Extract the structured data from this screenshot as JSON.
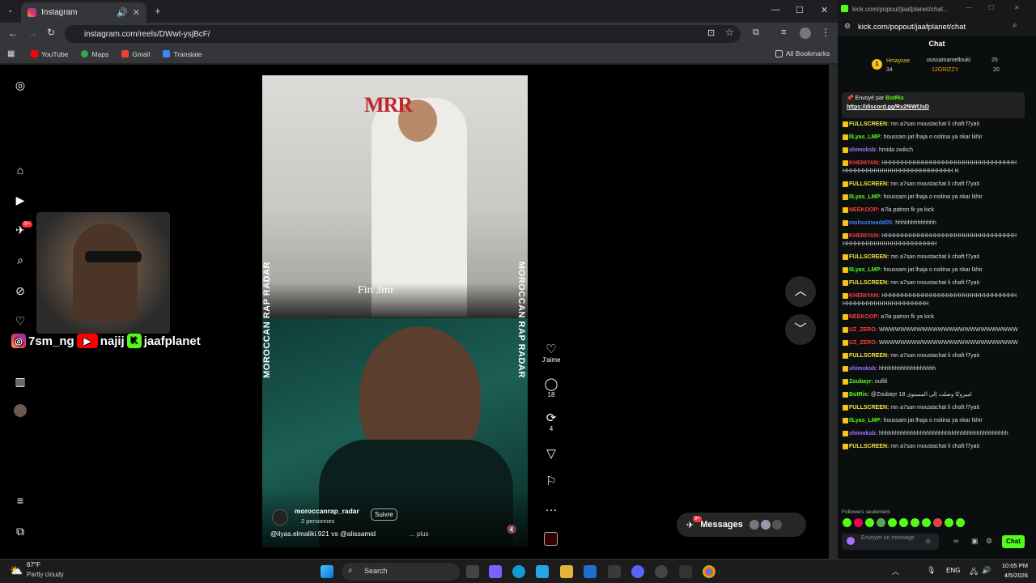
{
  "browser": {
    "tab_title": "Instagram",
    "url": "instagram.com/reels/DWwt-ysjBcF/",
    "bookmarks": [
      "YouTube",
      "Maps",
      "Gmail",
      "Translate"
    ],
    "all_bookmarks": "All Bookmarks"
  },
  "reel": {
    "top_caption": "Fin 3mr",
    "logo": "MRR",
    "side_text": "MOROCCAN RAP RADAR",
    "account": "moroccanrap_radar",
    "follow": "Suivre",
    "people": "2 personnes",
    "caption": "@ilyas.elmaliki.921 vs @alissamid",
    "more": "... plus",
    "likes_label": "J'aime",
    "comments": "18",
    "reposts": "4"
  },
  "messages": {
    "label": "Messages",
    "badge": "9+"
  },
  "notif_badge": "9+",
  "overlay": {
    "insta": "7sm_ng",
    "yt": "najij",
    "kick": "jaafplanet"
  },
  "chat_window": {
    "title": "kick.com/popout/jaafplanet/chat...",
    "url": "kick.com/popout/jaafplanet/chat",
    "heading": "Chat",
    "top1_name": "Hmaysse",
    "top1_val": "34",
    "top2_name": "oussamamellouki",
    "top2_val": "25",
    "top3_name": "12GRIZZY",
    "top3_val": "20",
    "pinned_by": "Envoyé par",
    "pinned_user": "BotRix",
    "pinned_link": "https://discord.gg/Rx2f6WfJsD",
    "followers_only": "Followers seulement",
    "input_placeholder": "Envoyer un message",
    "send_label": "Chat"
  },
  "chat_lines": [
    {
      "user": "FULLSCREEN:",
      "color": "#f5e73a",
      "text": "mn a7san moustachat li chaft f7yati"
    },
    {
      "user": "IlLyas_LMP:",
      "color": "#53fc18",
      "text": "houssam jat lhaja o nsitina ya nkar lkhir"
    },
    {
      "user": "shimoksb:",
      "color": "#a970ff",
      "text": "hmida zwikch"
    },
    {
      "user": "KHENIYAN:",
      "color": "#ff3b3b",
      "text": "HHHHHHHHHHHHHHHHHHHHHHHHHHHHHHHHHHHHHHHHHHHHHHHHHHHHHHHHHHHH H",
      "multi": true
    },
    {
      "user": "FULLSCREEN:",
      "color": "#f5e73a",
      "text": "mn a7san moustachat li chaft f7yati"
    },
    {
      "user": "IlLyas_LMP:",
      "color": "#53fc18",
      "text": "houssam jat lhaja o nsitina ya nkar lkhir"
    },
    {
      "user": "NEEKOOP:",
      "color": "#ff3b3b",
      "text": "a7la patron fk ya kick"
    },
    {
      "user": "mohssineadd05:",
      "color": "#3b82f6",
      "text": "hhhhhhhhhhhhh"
    },
    {
      "user": "KHENIYAN:",
      "color": "#ff3b3b",
      "text": "HHHHHHHHHHHHHHHHHHHHHHHHHHHHHHHHHHHHHHHHHHHHHHHHHHHHHHHH",
      "multi": true
    },
    {
      "user": "FULLSCREEN:",
      "color": "#f5e73a",
      "text": "mn a7san moustachat li chaft f7yati"
    },
    {
      "user": "IlLyas_LMP:",
      "color": "#53fc18",
      "text": "houssam jat lhaja o nsitina ya nkar lkhir"
    },
    {
      "user": "FULLSCREEN:",
      "color": "#f5e73a",
      "text": "mn a7san moustachat li chaft f7yati"
    },
    {
      "user": "KHENIYAN:",
      "color": "#ff3b3b",
      "text": "HHHHHHHHHHHHHHHHHHHHHHHHHHHHHHHHHHHHHHHHHHHHHHHHHHHHHH",
      "multi": true
    },
    {
      "user": "NEEKOOP:",
      "color": "#ff3b3b",
      "text": "a7la patron fk ya kick"
    },
    {
      "user": "UZ_ZERO:",
      "color": "#ff3b3b",
      "text": "WWWWWWWWWWWWWWWWWWWWWWWWWW",
      "multi": true
    },
    {
      "user": "UZ_ZERO:",
      "color": "#ff3b3b",
      "text": "WWWWWWWWWWWWWWWWWWWWWWWWWW",
      "multi": true
    },
    {
      "user": "FULLSCREEN:",
      "color": "#f5e73a",
      "text": "mn a7san moustachat li chaft f7yati"
    },
    {
      "user": "shimoksb:",
      "color": "#a970ff",
      "text": "hhhhhhhhhhhhhhhhhh"
    },
    {
      "user": "Zoubayr:",
      "color": "#53fc18",
      "text": "oullili"
    },
    {
      "user": "BotRix:",
      "color": "#53fc18",
      "text": "@Zoubayr 18 اميروكا وصلت إلى المستوى"
    },
    {
      "user": "FULLSCREEN:",
      "color": "#f5e73a",
      "text": "mn a7san moustachat li chaft f7yati"
    },
    {
      "user": "IlLyas_LMP:",
      "color": "#53fc18",
      "text": "houssam jat lhaja o nsitina ya nkar lkhir"
    },
    {
      "user": "shimoksb:",
      "color": "#a970ff",
      "text": "hhhhhhhhhhhhhhhhhhhhhhhhhhhhhhhhhhhhhhhhh"
    },
    {
      "user": "FULLSCREEN:",
      "color": "#f5e73a",
      "text": "mn a7san moustachat li chaft f7yati"
    }
  ],
  "taskbar": {
    "weather_temp": "67°F",
    "weather_desc": "Partly cloudy",
    "search": "Search",
    "lang": "ENG",
    "time": "10:05 PM",
    "date": "4/5/2026"
  }
}
